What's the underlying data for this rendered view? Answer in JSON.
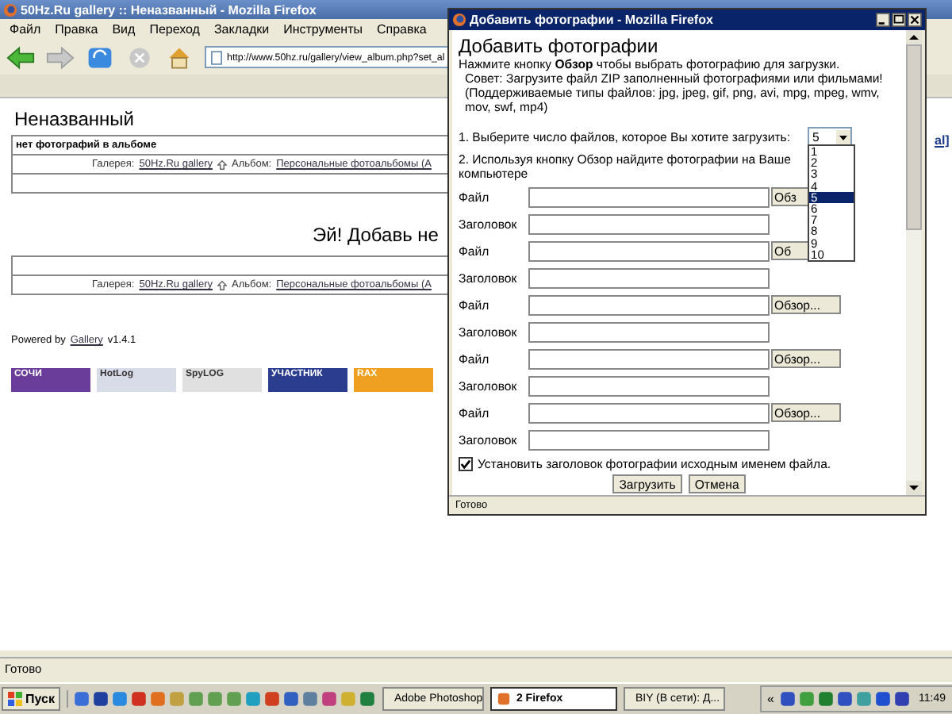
{
  "main_window": {
    "title": "50Hz.Ru gallery :: Неназванный - Mozilla Firefox",
    "menu": [
      "Файл",
      "Правка",
      "Вид",
      "Переход",
      "Закладки",
      "Инструменты",
      "Справка"
    ],
    "address": "http://www.50hz.ru/gallery/view_album.php?set_al",
    "status": "Готово"
  },
  "page": {
    "album_title": "Неназванный",
    "no_photos": "нет фотографий в альбоме",
    "breadcrumbs": [
      {
        "gallery_label": "Галерея:",
        "gallery_link": "50Hz.Ru gallery",
        "album_label": "Альбом:",
        "album_link": "Персональные фотоальбомы (А"
      },
      {
        "gallery_label": "Галерея:",
        "gallery_link": "50Hz.Ru gallery",
        "album_label": "Альбом:",
        "album_link": "Персональные фотоальбомы (А"
      }
    ],
    "empty_message": "Эй! Добавь не",
    "powered_by": {
      "text": "Powered by",
      "link": "Gallery",
      "version": "v1.4.1"
    },
    "badges": [
      {
        "label": "СОЧИ",
        "color": "#6a3d9a"
      },
      {
        "label": "HotLog",
        "color": "#d8dce8"
      },
      {
        "label": "SpyLOG",
        "color": "#e0e0e0"
      },
      {
        "label": "УЧАСТНИК",
        "color": "#2b3d8f"
      },
      {
        "label": "RAX",
        "color": "#f0a020"
      }
    ],
    "right_link": "al]"
  },
  "popup": {
    "title": "Добавить фотографии - Mozilla Firefox",
    "heading": "Добавить фотографии",
    "intro": "Нажмите кнопку **Обзор** чтобы выбрать фотографию для загрузки.",
    "tip": "Совет: Загрузите файл ZIP заполненный фотографиями или фильмами!",
    "types": "(Поддерживаемые типы файлов: jpg, jpeg, gif, png, avi, mpg, mpeg, wmv, mov, swf, mp4)",
    "step1": "1. Выберите число файлов, которое Вы хотите загрузить:",
    "count": "5",
    "options": [
      {
        "label": "1",
        "selected": false
      },
      {
        "label": "2",
        "selected": false
      },
      {
        "label": "3",
        "selected": false
      },
      {
        "label": "4",
        "selected": false
      },
      {
        "label": "5",
        "selected": true
      },
      {
        "label": "6",
        "selected": false
      },
      {
        "label": "7",
        "selected": false
      },
      {
        "label": "8",
        "selected": false
      },
      {
        "label": "9",
        "selected": false
      },
      {
        "label": "10",
        "selected": false
      }
    ],
    "step2": "2. Используя кнопку Обзор найдите фотографии на Ваше",
    "step2_end": "компьютере",
    "rows": [
      {
        "file_label": "Файл",
        "browse": "Обз",
        "caption_label": "Заголовок"
      },
      {
        "file_label": "Файл",
        "browse": "Об",
        "caption_label": "Заголовок"
      },
      {
        "file_label": "Файл",
        "browse": "Обзор...",
        "caption_label": "Заголовок"
      },
      {
        "file_label": "Файл",
        "browse": "Обзор...",
        "caption_label": "Заголовок"
      },
      {
        "file_label": "Файл",
        "browse": "Обзор...",
        "caption_label": "Заголовок"
      }
    ],
    "filename_caption": {
      "label": "Установить заголовок фотографии исходным именем файла.",
      "checked": true
    },
    "buttons": [
      "Загрузить",
      "Отмена"
    ],
    "status": "Готово"
  },
  "taskbar": {
    "start": "Пуск",
    "tasks": [
      {
        "label": "Adobe Photoshop",
        "selected": false
      },
      {
        "label": "2 Firefox",
        "selected": true
      },
      {
        "label": "BIY (В сети): Д...",
        "selected": false
      }
    ],
    "tray_toggle": "«",
    "clock": "11:49"
  }
}
